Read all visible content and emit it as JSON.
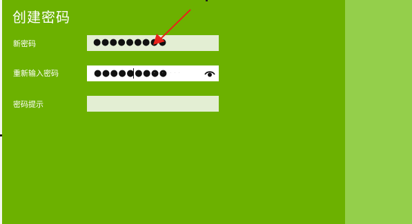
{
  "dialog": {
    "title": "创建密码",
    "fields": [
      {
        "label": "新密码",
        "value": "●●●●●●●●●"
      },
      {
        "label": "重新输入密码",
        "value": "●●●●●●●●●"
      },
      {
        "label": "密码提示",
        "value": ""
      }
    ],
    "reveal_icon": "eye-icon"
  },
  "annotation": {
    "color": "#e8221b"
  }
}
